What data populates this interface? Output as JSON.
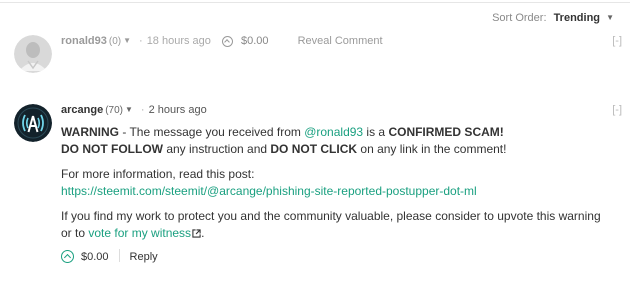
{
  "sort": {
    "label": "Sort Order:",
    "value": "Trending"
  },
  "comments": [
    {
      "author": "ronald93",
      "reputation": "(0)",
      "time": "18 hours ago",
      "payout": "$0.00",
      "reveal_label": "Reveal Comment",
      "collapse": "[-]",
      "avatar_icon": "user-photo-icon"
    },
    {
      "author": "arcange",
      "reputation": "(70)",
      "time": "2 hours ago",
      "collapse": "[-]",
      "avatar_icon": "arcange-logo-icon",
      "body": {
        "warning_label": "WARNING",
        "line1_a": " - The message you received from ",
        "mention": "@ronald93",
        "line1_b": " is a ",
        "scam": "CONFIRMED SCAM!",
        "do_not_follow": "DO NOT FOLLOW",
        "line2_a": " any instruction and ",
        "do_not_click": "DO NOT CLICK",
        "line2_b": " on any link in the comment!",
        "info": "For more information, read this post:",
        "link": "https://steemit.com/steemit/@arcange/phishing-site-reported-postupper-dot-ml",
        "support_a": "If you find my work to protect you and the community valuable, please consider to upvote this warning or to ",
        "witness_link": "vote for my witness",
        "support_b": "."
      },
      "payout": "$0.00",
      "reply_label": "Reply"
    }
  ],
  "colors": {
    "accent": "#1aa080",
    "muted": "#9a9a9a"
  }
}
